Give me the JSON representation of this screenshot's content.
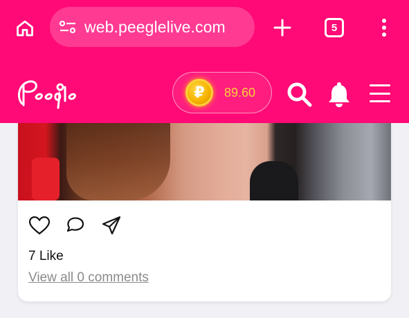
{
  "browser": {
    "url": "web.peeglelive.com",
    "tab_count": "5",
    "icons": [
      "home-icon",
      "tune-icon",
      "plus-icon",
      "tab-switcher-icon",
      "more-vertical-icon"
    ],
    "bar_color": "#ff0a76",
    "pill_color": "#ff3a93"
  },
  "header": {
    "logo_text": "Peegle",
    "logo_sub": "live",
    "coin_symbol": "₽",
    "balance": "89.60",
    "icons": [
      "search-icon",
      "bell-icon",
      "hamburger-menu-icon"
    ],
    "accent": "#ff0a76",
    "balance_color": "#ffd23a"
  },
  "post": {
    "like_count_text": "7 Like",
    "comments_link": "View all 0 comments",
    "action_icons": [
      "heart-icon",
      "comment-icon",
      "share-send-icon"
    ]
  }
}
